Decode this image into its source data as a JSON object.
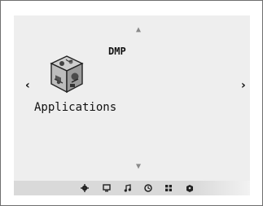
{
  "header": {
    "title": "DMP"
  },
  "menu": {
    "item_label": "Applications",
    "item_icon": "applications-box-icon"
  },
  "nav": {
    "up_icon": "arrow-up-icon",
    "down_icon": "arrow-down-icon",
    "left_glyph": "‹",
    "right_glyph": "›"
  },
  "bottom_bar": {
    "icons": [
      "settings-icon",
      "monitor-icon",
      "music-icon",
      "clock-icon",
      "grid-icon",
      "applications-icon"
    ]
  },
  "colors": {
    "screen_bg": "#eeeeee",
    "bar_bg": "#d9d9d9",
    "arrow": "#8a8a8a"
  }
}
